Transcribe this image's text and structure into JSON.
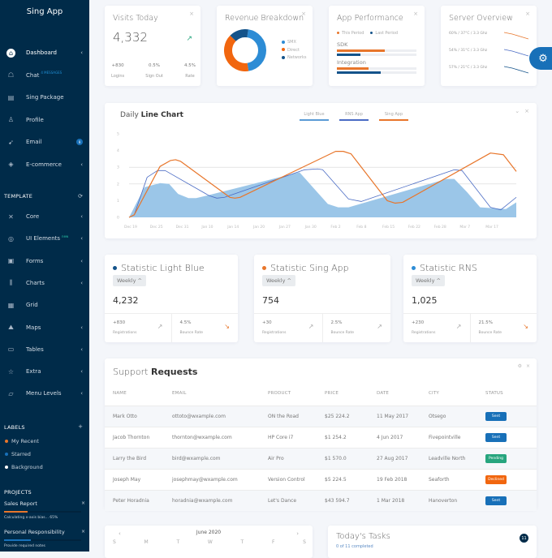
{
  "app": {
    "title": "Sing App"
  },
  "sidebar": {
    "items": [
      {
        "label": "Dashboard",
        "icon": "home-icon",
        "active": true,
        "chevron": true
      },
      {
        "label": "Chat",
        "icon": "chat-icon",
        "sup": "4 MESSAGES",
        "chevron": false
      },
      {
        "label": "Sing Package",
        "icon": "package-icon",
        "chevron": false
      },
      {
        "label": "Profile",
        "icon": "user-icon",
        "chevron": false
      },
      {
        "label": "Email",
        "icon": "paper-plane-icon",
        "badge": "9",
        "chevron": false
      },
      {
        "label": "E-commerce",
        "icon": "diamond-icon",
        "chevron": true
      }
    ],
    "template_section": {
      "title": "TEMPLATE",
      "action_icon": "refresh-icon"
    },
    "template_items": [
      {
        "label": "Core",
        "icon": "tools-icon",
        "chevron": true
      },
      {
        "label": "UI Elements",
        "icon": "layers-icon",
        "sup": "new",
        "chevron": true
      },
      {
        "label": "Forms",
        "icon": "form-icon",
        "chevron": true
      },
      {
        "label": "Charts",
        "icon": "chart-icon",
        "chevron": true
      },
      {
        "label": "Grid",
        "icon": "grid-icon",
        "chevron": false
      },
      {
        "label": "Maps",
        "icon": "map-icon",
        "chevron": true
      },
      {
        "label": "Tables",
        "icon": "table-icon",
        "chevron": true
      },
      {
        "label": "Extra",
        "icon": "star-icon",
        "chevron": true
      },
      {
        "label": "Menu Levels",
        "icon": "folder-icon",
        "chevron": true
      }
    ],
    "labels_section": {
      "title": "LABELS",
      "action": "+"
    },
    "labels": [
      {
        "label": "My Recent",
        "color": "#e8762b"
      },
      {
        "label": "Starred",
        "color": "#1870b8"
      },
      {
        "label": "Background",
        "color": "#ffffff"
      }
    ],
    "projects_section": {
      "title": "PROJECTS"
    },
    "projects": [
      {
        "name": "Sales Report",
        "note": "Calculating x-axis bias... 65%",
        "progress": 0.3,
        "color": "#e8762b"
      },
      {
        "name": "Personal Responsibility",
        "note": "Provide required notes",
        "progress": 0.35,
        "color": "#1870b8"
      }
    ]
  },
  "widgets": {
    "visits": {
      "title": "Visits Today",
      "value": "4,332",
      "trend_icon": "arrow-up-right-icon",
      "stats": [
        {
          "value": "+830",
          "label": "Logins"
        },
        {
          "value": "0.5%",
          "label": "Sign Out"
        },
        {
          "value": "4.5%",
          "label": "Rate"
        }
      ]
    },
    "revenue": {
      "title": "Revenue Breakdown",
      "slices": [
        {
          "label": "SMX",
          "value": 45,
          "color": "#2d8cd5"
        },
        {
          "label": "Direct",
          "value": 40,
          "color": "#f1660f"
        },
        {
          "label": "Networks",
          "value": 15,
          "color": "#14538a"
        }
      ]
    },
    "performance": {
      "title": "App Performance",
      "legend": [
        {
          "label": "This Period",
          "color": "#e8762b"
        },
        {
          "label": "Last Period",
          "color": "#14538a"
        }
      ],
      "metrics": [
        {
          "label": "SDK",
          "this": 0.6,
          "last": 0.3
        },
        {
          "label": "Integration",
          "this": 0.4,
          "last": 0.55
        }
      ]
    },
    "server": {
      "title": "Server Overview",
      "rows": [
        {
          "text": "60% / 37°C / 3.3 Ghz",
          "color": "#e8762b"
        },
        {
          "text": "54% / 31°C / 3.3 Ghz",
          "color": "#4a6bc4"
        },
        {
          "text": "57% / 21°C / 3.3 Ghz",
          "color": "#14538a"
        }
      ]
    }
  },
  "line_chart": {
    "title_light": "Daily",
    "title_bold": "Line Chart",
    "legend": [
      {
        "label": "Light Blue",
        "color": "#5b9bd5"
      },
      {
        "label": "RNS App",
        "color": "#4a6bc4"
      },
      {
        "label": "Sing App",
        "color": "#e8762b"
      }
    ]
  },
  "chart_data": {
    "type": "line",
    "title": "Daily Line Chart",
    "x": [
      "Dec 19",
      "Dec 25",
      "Dec 31",
      "Jan 10",
      "Jan 14",
      "Jan 20",
      "Jan 27",
      "Jan 30",
      "Feb 2",
      "Feb 8",
      "Feb 15",
      "Feb 22",
      "Feb 28",
      "Mar 7",
      "Mar 17"
    ],
    "yticks": [
      0,
      1,
      2,
      3,
      4,
      5
    ],
    "ylim": [
      0,
      5
    ],
    "series": [
      {
        "name": "Light Blue",
        "type": "area",
        "color": "#9bc6e8",
        "points": [
          [
            0,
            0
          ],
          [
            0.6,
            1.8
          ],
          [
            1.2,
            2.05
          ],
          [
            1.55,
            2.0
          ],
          [
            1.9,
            1.4
          ],
          [
            2.3,
            1.15
          ],
          [
            2.6,
            1.15
          ],
          [
            3.0,
            1.3
          ],
          [
            6.6,
            2.7
          ],
          [
            7.7,
            0.8
          ],
          [
            8.1,
            0.6
          ],
          [
            8.5,
            0.6
          ],
          [
            12.3,
            2.3
          ],
          [
            12.6,
            2.3
          ],
          [
            13.1,
            1.5
          ],
          [
            13.6,
            0.6
          ],
          [
            14.6,
            0.5
          ],
          [
            15.0,
            0.9
          ]
        ]
      },
      {
        "name": "RNS App",
        "type": "line",
        "color": "#4a6bc4",
        "points": [
          [
            0,
            0
          ],
          [
            0.2,
            0.15
          ],
          [
            0.7,
            2.4
          ],
          [
            1.1,
            2.8
          ],
          [
            1.4,
            2.8
          ],
          [
            3.1,
            1.3
          ],
          [
            3.4,
            1.15
          ],
          [
            3.7,
            1.2
          ],
          [
            6.8,
            2.85
          ],
          [
            7.3,
            2.9
          ],
          [
            7.5,
            2.85
          ],
          [
            8.5,
            1.1
          ],
          [
            9.0,
            0.95
          ],
          [
            12.6,
            2.85
          ],
          [
            12.9,
            2.8
          ],
          [
            14.0,
            0.6
          ],
          [
            14.4,
            0.45
          ],
          [
            15.0,
            1.2
          ]
        ]
      },
      {
        "name": "Sing App",
        "type": "line",
        "color": "#e8762b",
        "points": [
          [
            0,
            0
          ],
          [
            0.2,
            0.15
          ],
          [
            1.2,
            3.05
          ],
          [
            1.6,
            3.4
          ],
          [
            1.8,
            3.45
          ],
          [
            2.0,
            3.35
          ],
          [
            3.9,
            1.2
          ],
          [
            4.1,
            1.15
          ],
          [
            4.3,
            1.2
          ],
          [
            8.0,
            3.95
          ],
          [
            8.3,
            3.95
          ],
          [
            8.6,
            3.8
          ],
          [
            10.0,
            1.0
          ],
          [
            10.3,
            0.85
          ],
          [
            10.6,
            0.9
          ],
          [
            14.0,
            3.85
          ],
          [
            14.5,
            3.75
          ],
          [
            15.0,
            2.75
          ]
        ]
      }
    ]
  },
  "stats": [
    {
      "title": "Statistic Light Blue",
      "dot": "#14538a",
      "period": "Weekly",
      "value": "4,232",
      "left": {
        "value": "+830",
        "label": "Registrations",
        "trend": "up"
      },
      "right": {
        "value": "4.5%",
        "label": "Bounce Rate",
        "trend": "down"
      }
    },
    {
      "title": "Statistic Sing App",
      "dot": "#e8762b",
      "period": "Weekly",
      "value": "754",
      "left": {
        "value": "+30",
        "label": "Registrations",
        "trend": "up"
      },
      "right": {
        "value": "2.5%",
        "label": "Bounce Rate",
        "trend": "up"
      }
    },
    {
      "title": "Statistic RNS",
      "dot": "#2d8cd5",
      "period": "Weekly",
      "value": "1,025",
      "left": {
        "value": "+230",
        "label": "Registrations",
        "trend": "up"
      },
      "right": {
        "value": "21.5%",
        "label": "Bounce Rate",
        "trend": "down"
      }
    }
  ],
  "support": {
    "title_light": "Support",
    "title_bold": "Requests",
    "columns": [
      "NAME",
      "EMAIL",
      "PRODUCT",
      "PRICE",
      "DATE",
      "CITY",
      "STATUS"
    ],
    "rows": [
      {
        "name": "Mark Otto",
        "email": "ottoto@wxample.com",
        "product": "ON the Road",
        "price": "$25 224.2",
        "date": "11 May 2017",
        "city": "Otsego",
        "status": "Sent"
      },
      {
        "name": "Jacob Thornton",
        "email": "thornton@wxample.com",
        "product": "HP Core i7",
        "price": "$1 254.2",
        "date": "4 Jun 2017",
        "city": "Fivepointville",
        "status": "Sent"
      },
      {
        "name": "Larry the Bird",
        "email": "bird@wxample.com",
        "product": "Air Pro",
        "price": "$1 570.0",
        "date": "27 Aug 2017",
        "city": "Leadville North",
        "status": "Pending"
      },
      {
        "name": "Joseph May",
        "email": "josephmay@wxample.com",
        "product": "Version Control",
        "price": "$5 224.5",
        "date": "19 Feb 2018",
        "city": "Seaforth",
        "status": "Declined"
      },
      {
        "name": "Peter Horadnia",
        "email": "horadnia@wxample.com",
        "product": "Let's Dance",
        "price": "$43 594.7",
        "date": "1 Mar 2018",
        "city": "Hanoverton",
        "status": "Sent"
      }
    ],
    "status_colors": {
      "Sent": "#1870b8",
      "Pending": "#27a57e",
      "Declined": "#f1660f"
    }
  },
  "calendar": {
    "month": "June 2020",
    "prev": "‹",
    "next": "›",
    "days": [
      "S",
      "M",
      "T",
      "W",
      "T",
      "F",
      "S"
    ]
  },
  "tasks": {
    "title": "Today's Tasks",
    "subtitle": "0 of 11 completed",
    "count": "11"
  }
}
